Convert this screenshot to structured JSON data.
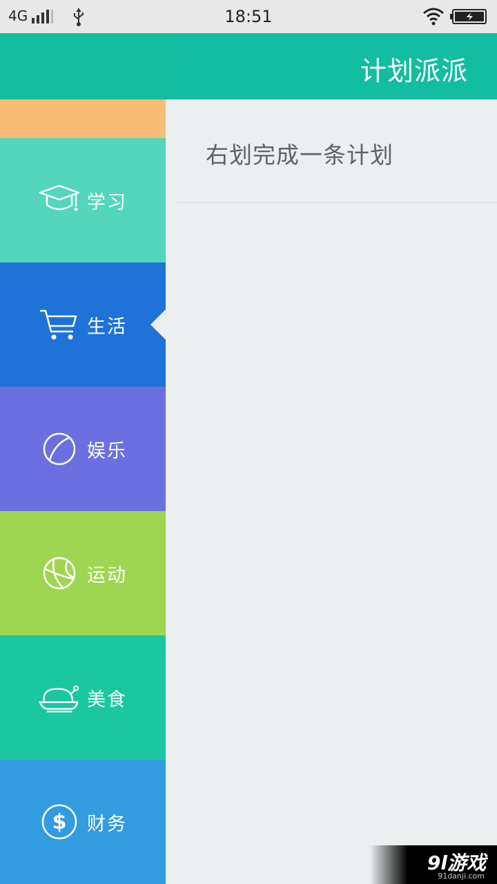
{
  "status_bar": {
    "network": "4G",
    "time": "18:51"
  },
  "header": {
    "title": "计划派派"
  },
  "sidebar": {
    "items": [
      {
        "label": "学习",
        "icon": "graduation-cap-icon",
        "color": "#53d6bb"
      },
      {
        "label": "生活",
        "icon": "shopping-cart-icon",
        "color": "#1f73d8",
        "selected": true
      },
      {
        "label": "娱乐",
        "icon": "ball-icon",
        "color": "#6c6fdf"
      },
      {
        "label": "运动",
        "icon": "basketball-icon",
        "color": "#9fd651"
      },
      {
        "label": "美食",
        "icon": "roast-chicken-icon",
        "color": "#1bc79f"
      },
      {
        "label": "财务",
        "icon": "dollar-icon",
        "color": "#339ce1"
      }
    ]
  },
  "main": {
    "plan_hint": "右划完成一条计划"
  },
  "watermark": {
    "main": "9l游戏",
    "sub": "91danji.com"
  }
}
